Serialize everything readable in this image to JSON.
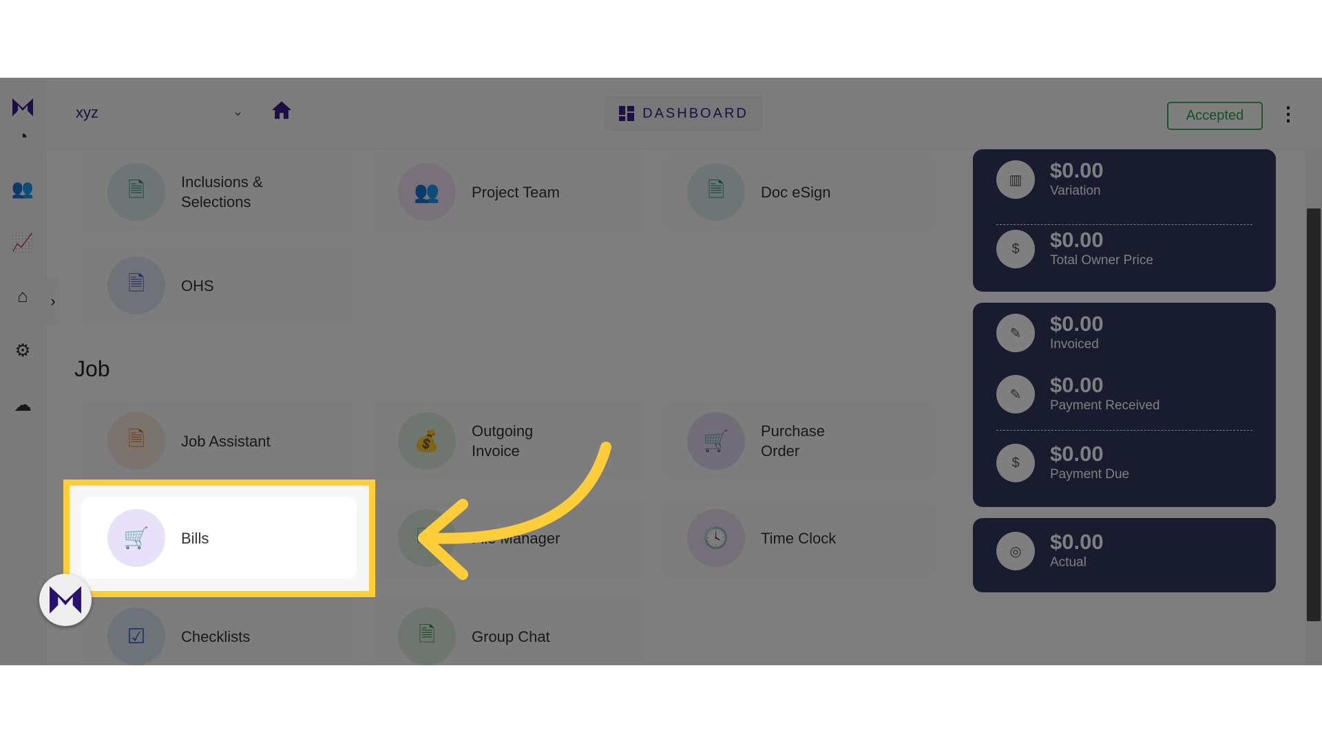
{
  "header": {
    "project": "xyz",
    "dashboard_label": "DASHBOARD",
    "status": "Accepted"
  },
  "sidebar": {
    "icons": [
      "dashboard-gauge-icon",
      "team-icon",
      "chart-icon",
      "presentation-icon",
      "settings-icon",
      "cloud-icon"
    ]
  },
  "sections": {
    "top_cards": [
      {
        "label": "Inclusions & Selections",
        "icon": "document-icon",
        "color": "#1f8a8a"
      },
      {
        "label": "Project Team",
        "icon": "team-icon",
        "color": "#b34fd1"
      },
      {
        "label": "Doc eSign",
        "icon": "document-icon",
        "color": "#1f8a8a"
      },
      {
        "label": "OHS",
        "icon": "document-icon",
        "color": "#3b5bd6"
      }
    ],
    "job_title": "Job",
    "job_cards": [
      {
        "label": "Job Assistant",
        "icon": "document-icon",
        "color": "#e07b1f"
      },
      {
        "label": "Outgoing Invoice",
        "icon": "money-bag-icon",
        "color": "#2e9a3e"
      },
      {
        "label": "Purchase Order",
        "icon": "cart-icon",
        "color": "#4a1fd6"
      },
      {
        "label": "Bills",
        "icon": "cart-icon",
        "color": "#4a1fd6"
      },
      {
        "label": "File Manager",
        "icon": "folder-icon",
        "color": "#2e9a3e"
      },
      {
        "label": "Time Clock",
        "icon": "clock-icon",
        "color": "#7a2fc9"
      },
      {
        "label": "Checklists",
        "icon": "checkbox-icon",
        "color": "#1f6fd6"
      },
      {
        "label": "Group Chat",
        "icon": "document-icon",
        "color": "#2e9a3e"
      }
    ]
  },
  "stats": [
    {
      "amount": "$0.00",
      "label": "Variation"
    },
    {
      "amount": "$0.00",
      "label": "Total Owner Price"
    },
    {
      "amount": "$0.00",
      "label": "Invoiced"
    },
    {
      "amount": "$0.00",
      "label": "Payment Received"
    },
    {
      "amount": "$0.00",
      "label": "Payment Due"
    },
    {
      "amount": "$0.00",
      "label": "Actual"
    }
  ],
  "highlight_color": "#fecd3a"
}
